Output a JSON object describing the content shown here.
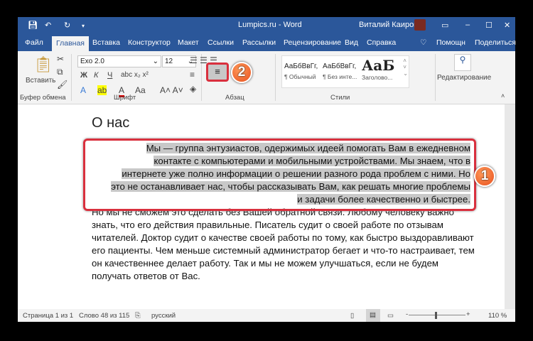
{
  "titlebar": {
    "title": "Lumpics.ru - Word",
    "user": "Виталий Каиров"
  },
  "tabs": [
    "Файл",
    "Главная",
    "Вставка",
    "Конструктор",
    "Макет",
    "Ссылки",
    "Рассылки",
    "Рецензирование",
    "Вид",
    "Справка"
  ],
  "tab_help": "Помощн",
  "tab_share": "Поделиться",
  "ribbon": {
    "paste": "Вставить",
    "clipboard": "Буфер обмена",
    "font_name": "Exo 2.0",
    "font_size": "12",
    "font": "Шрифт",
    "paragraph": "Абзац",
    "styles": "Стили",
    "editing": "Редактирование",
    "bold": "Ж",
    "italic": "К",
    "underline": "Ч",
    "style_items": [
      {
        "sample": "АаБбВвГг,",
        "name": "¶ Обычный"
      },
      {
        "sample": "АаБбВвГг,",
        "name": "¶ Без инте..."
      },
      {
        "sample": "АаБ",
        "name": "Заголово..."
      }
    ]
  },
  "document": {
    "heading": "О нас",
    "selected_lines": [
      "Мы — группа энтузиастов, одержимых идеей помогать Вам в ежедневном",
      "контакте с компьютерами и мобильными устройствами. Мы знаем, что в",
      "интернете уже полно информации о решении разного рода проблем с ними. Но",
      "это не останавливает нас, чтобы рассказывать Вам, как решать многие проблемы",
      "и задачи более качественно и быстрее."
    ],
    "paragraph2": "Но мы не сможем это сделать без Вашей обратной связи. Любому человеку важно знать, что его действия правильные. Писатель судит о своей работе по отзывам читателей. Доктор судит о качестве своей работы по тому, как быстро выздоравливают его пациенты. Чем меньше системный администратор бегает и что-то настраивает, тем он качественнее делает работу. Так и мы не можем улучшаться, если не будем получать ответов от Вас."
  },
  "annotations": {
    "badge1": "1",
    "badge2": "2"
  },
  "status": {
    "page": "Страница 1 из 1",
    "words": "Слово 48 из 115",
    "language": "русский",
    "zoom": "110 %"
  },
  "colors": {
    "accent": "#2b579a",
    "highlight": "#d9303e"
  }
}
